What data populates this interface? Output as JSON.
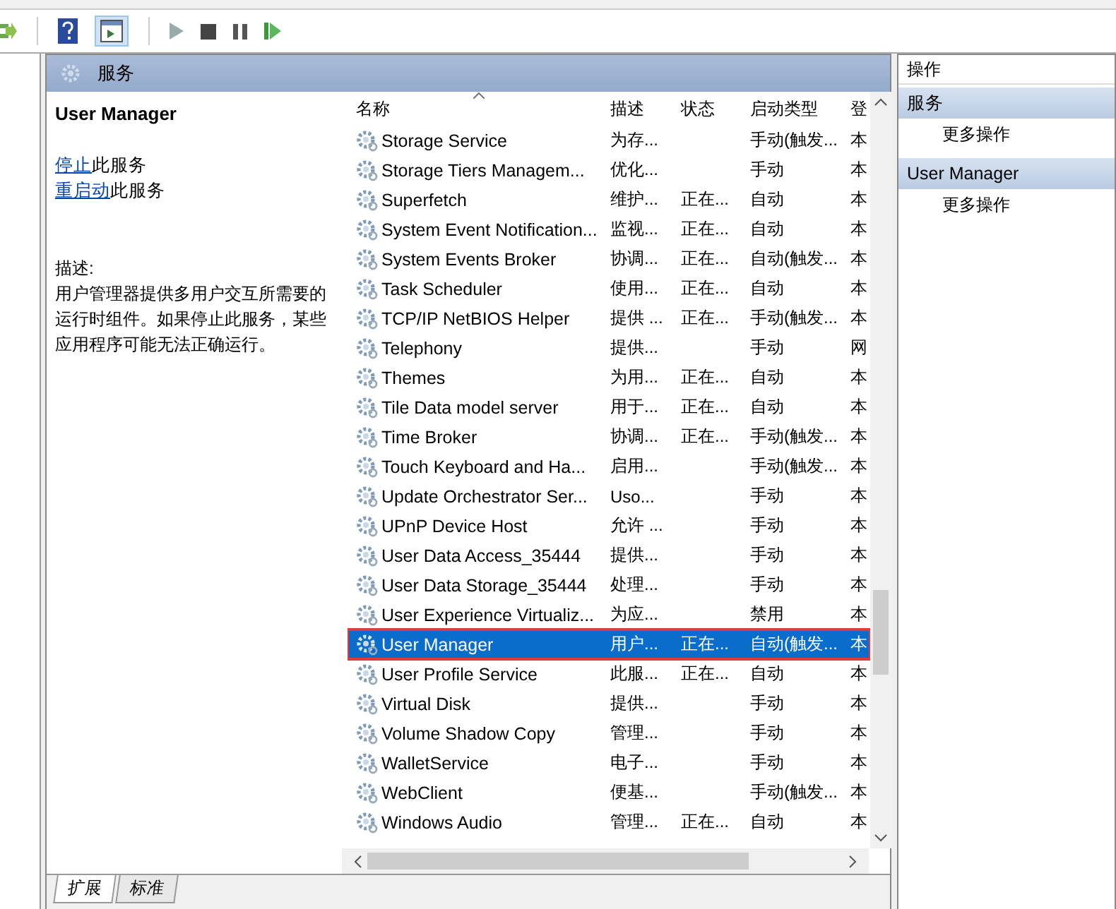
{
  "panel_title": "服务",
  "details": {
    "service_name": "User Manager",
    "links": [
      {
        "link": "停止",
        "text": "此服务"
      },
      {
        "link": "重启动",
        "text": "此服务"
      }
    ],
    "description_label": "描述:",
    "description": "用户管理器提供多用户交互所需要的运行时组件。如果停止此服务，某些应用程序可能无法正确运行。"
  },
  "table": {
    "columns": [
      "名称",
      "描述",
      "状态",
      "启动类型",
      "登"
    ],
    "rows": [
      {
        "name": "Storage Service",
        "description": "为存...",
        "startup": "手动(触发...",
        "column_5": "本",
        "selected": false
      },
      {
        "name": "Storage Tiers Managem...",
        "description": "优化...",
        "startup": "手动",
        "column_5": "本",
        "selected": false
      },
      {
        "name": "Superfetch",
        "description": "维护...",
        "status": "正在...",
        "startup": "自动",
        "column_5": "本",
        "selected": false
      },
      {
        "name": "System Event Notification...",
        "description": "监视...",
        "status": "正在...",
        "startup": "自动",
        "column_5": "本",
        "selected": false
      },
      {
        "name": "System Events Broker",
        "description": "协调...",
        "status": "正在...",
        "startup": "自动(触发...",
        "column_5": "本",
        "selected": false
      },
      {
        "name": "Task Scheduler",
        "description": "使用...",
        "status": "正在...",
        "startup": "自动",
        "column_5": "本",
        "selected": false
      },
      {
        "name": "TCP/IP NetBIOS Helper",
        "description": "提供 ...",
        "status": "正在...",
        "startup": "手动(触发...",
        "column_5": "本",
        "selected": false
      },
      {
        "name": "Telephony",
        "description": "提供...",
        "startup": "手动",
        "column_5": "网",
        "selected": false
      },
      {
        "name": "Themes",
        "description": "为用...",
        "status": "正在...",
        "startup": "自动",
        "column_5": "本",
        "selected": false
      },
      {
        "name": "Tile Data model server",
        "description": "用于...",
        "status": "正在...",
        "startup": "自动",
        "column_5": "本",
        "selected": false
      },
      {
        "name": "Time Broker",
        "description": "协调...",
        "status": "正在...",
        "startup": "手动(触发...",
        "column_5": "本",
        "selected": false
      },
      {
        "name": "Touch Keyboard and Ha...",
        "description": "启用...",
        "startup": "手动(触发...",
        "column_5": "本",
        "selected": false
      },
      {
        "name": "Update Orchestrator Ser...",
        "description": "Uso...",
        "startup": "手动",
        "column_5": "本",
        "selected": false
      },
      {
        "name": "UPnP Device Host",
        "description": "允许 ...",
        "startup": "手动",
        "column_5": "本",
        "selected": false
      },
      {
        "name": "User Data Access_35444",
        "description": "提供...",
        "startup": "手动",
        "column_5": "本",
        "selected": false
      },
      {
        "name": "User Data Storage_35444",
        "description": "处理...",
        "startup": "手动",
        "column_5": "本",
        "selected": false
      },
      {
        "name": "User Experience Virtualiz...",
        "description": "为应...",
        "startup": "禁用",
        "column_5": "本",
        "selected": false
      },
      {
        "name": "User Manager",
        "description": "用户...",
        "status": "正在...",
        "startup": "自动(触发...",
        "column_5": "本",
        "selected": true
      },
      {
        "name": "User Profile Service",
        "description": "此服...",
        "status": "正在...",
        "startup": "自动",
        "column_5": "本",
        "selected": false
      },
      {
        "name": "Virtual Disk",
        "description": "提供...",
        "startup": "手动",
        "column_5": "本",
        "selected": false
      },
      {
        "name": "Volume Shadow Copy",
        "description": "管理...",
        "startup": "手动",
        "column_5": "本",
        "selected": false
      },
      {
        "name": "WalletService",
        "description": "电子...",
        "startup": "手动",
        "column_5": "本",
        "selected": false
      },
      {
        "name": "WebClient",
        "description": "便基...",
        "startup": "手动(触发...",
        "column_5": "本",
        "selected": false
      },
      {
        "name": "Windows Audio",
        "description": "管理...",
        "status": "正在...",
        "startup": "自动",
        "column_5": "本",
        "selected": false
      }
    ]
  },
  "actions": {
    "title": "操作",
    "groups": [
      {
        "title": "服务",
        "items": [
          "更多操作"
        ]
      },
      {
        "title": "User Manager",
        "items": [
          "更多操作"
        ]
      }
    ]
  },
  "bottom_tabs": [
    {
      "label": "扩展",
      "selected": true
    },
    {
      "label": "标准",
      "selected": false
    }
  ]
}
